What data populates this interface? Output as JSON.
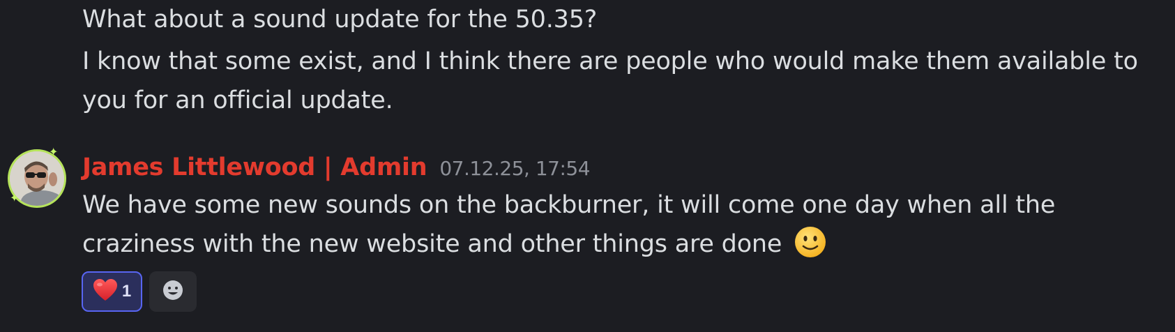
{
  "previous_message": {
    "lines": [
      "What about a sound update for the 50.35?",
      "I know that some exist, and I think there are people who would make them available to",
      "you for an official update."
    ]
  },
  "reply": {
    "author": "James Littlewood | Admin",
    "author_color": "#e33b2e",
    "timestamp": "07.12.25, 17:54",
    "lines": [
      "We have some new sounds on the backburner, it will come one day when all the",
      "craziness with the new website and other things are done"
    ],
    "trailing_emoji": "slightly-smiling-face"
  },
  "reactions": [
    {
      "emoji": "red-heart",
      "count": "1",
      "active": true
    },
    {
      "type": "add-reaction",
      "icon": "smiley-add-icon"
    }
  ],
  "colors": {
    "background": "#1c1d22",
    "text": "#dbdee1",
    "timestamp": "#8e9199",
    "reaction_active_bg": "#2b2f5c",
    "reaction_active_border": "#5865f2",
    "avatar_ring": "#b5e35a"
  }
}
